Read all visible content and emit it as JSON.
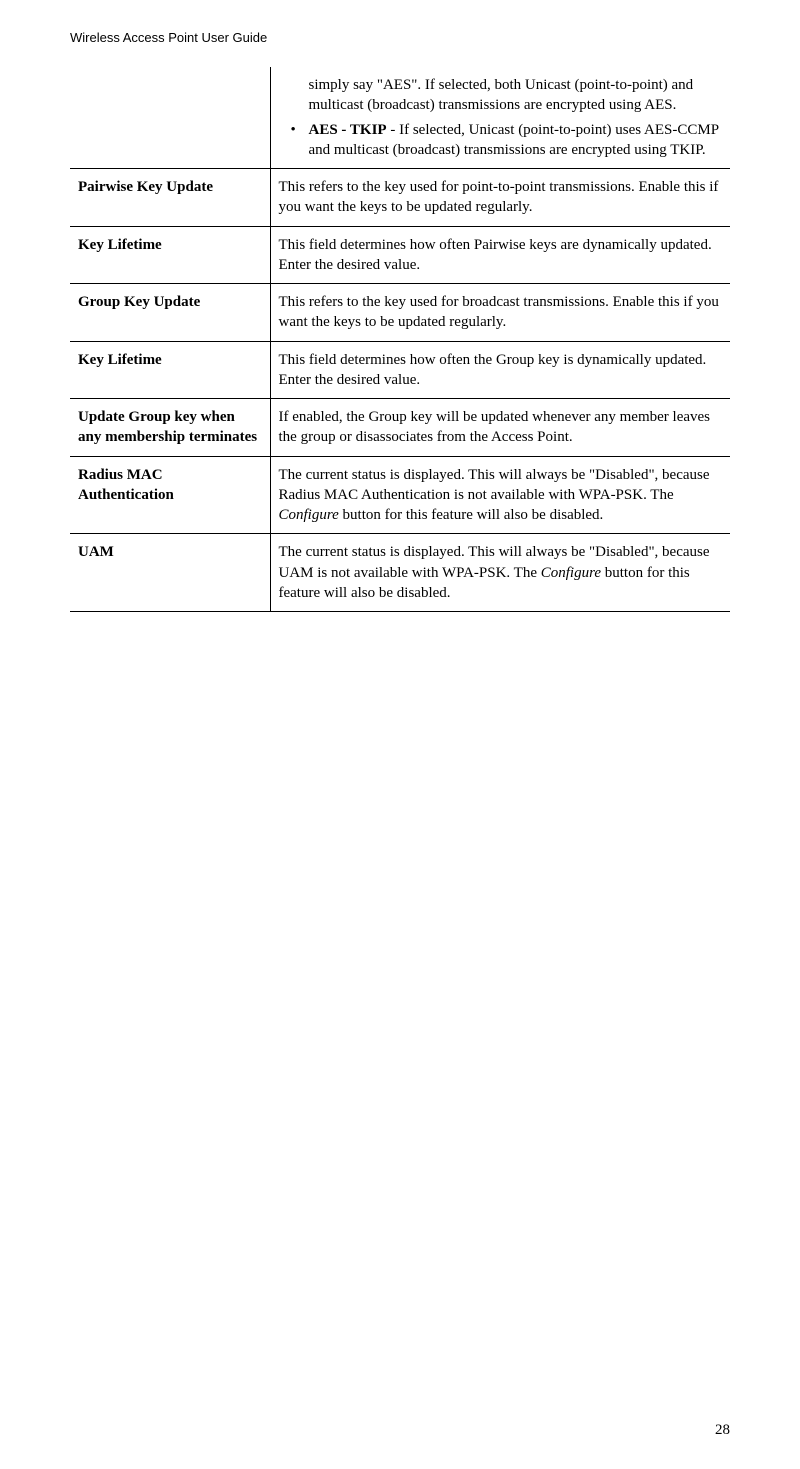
{
  "header": "Wireless Access Point User Guide",
  "pageNumber": "28",
  "rows": [
    {
      "label": "",
      "intro": "simply say \"AES\". If selected, both Unicast (point-to-point) and multicast (broadcast) transmissions are encrypted using AES.",
      "bullet": {
        "title": "AES - TKIP",
        "sep": " - ",
        "rest": "If selected, Unicast (point-to-point) uses AES-CCMP and multicast (broadcast) transmissions are encrypted using TKIP."
      }
    },
    {
      "label": "Pairwise Key Update",
      "text": "This refers to the key used for point-to-point transmissions. Enable this if you want the keys to be updated regularly."
    },
    {
      "label": "Key Lifetime",
      "text": "This field determines how often Pairwise keys are dynamically updated. Enter the desired value."
    },
    {
      "label": "Group Key Update",
      "text": "This refers to the key used for broadcast transmissions. Enable this if you want the keys to be updated regularly."
    },
    {
      "label": "Key Lifetime",
      "text": "This field determines how often the Group key is dynamically updated. Enter the desired value."
    },
    {
      "label": "Update Group key when any membership terminates",
      "text": "If enabled, the Group key will be updated whenever any member leaves the group or disassociates from the Access Point."
    },
    {
      "label": "Radius MAC Authentication",
      "pre": "The current status is displayed. This will always be \"Disabled\", because Radius MAC Authentication is not available with WPA-PSK. The ",
      "italic": "Configure",
      "post": " button for this feature will also be disabled."
    },
    {
      "label": "UAM",
      "pre": "The current status is displayed. This will always be \"Disabled\", because UAM is not available with WPA-PSK. The ",
      "italic": "Configure",
      "post": " button for this feature will also be disabled."
    }
  ]
}
